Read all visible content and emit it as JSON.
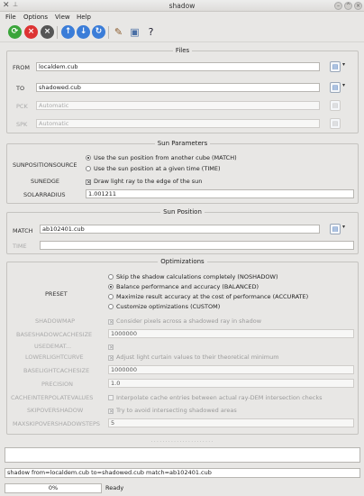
{
  "window": {
    "title": "shadow"
  },
  "menu": [
    "File",
    "Options",
    "View",
    "Help"
  ],
  "toolbar": {
    "icons": [
      "run-icon",
      "stop-icon",
      "reset-icon",
      "arrow-up-icon",
      "arrow-down-icon",
      "refresh-icon",
      "edit-icon",
      "window-icon",
      "whats-this-icon"
    ]
  },
  "files": {
    "title": "Files",
    "from_label": "FROM",
    "from_value": "localdem.cub",
    "to_label": "TO",
    "to_value": "shadowed.cub",
    "pck_label": "PCK",
    "pck_placeholder": "Automatic",
    "spk_label": "SPK",
    "spk_placeholder": "Automatic"
  },
  "sun_params": {
    "title": "Sun Parameters",
    "source_label": "SUNPOSITIONSOURCE",
    "opt_match": "Use the sun position from another cube (MATCH)",
    "opt_time": "Use the sun position at a given time (TIME)",
    "sunedge_label": "SUNEDGE",
    "sunedge_text": "Draw light ray to the edge of the sun",
    "solarradius_label": "SOLARRADIUS",
    "solarradius_value": "1.001211"
  },
  "sun_position": {
    "title": "Sun Position",
    "match_label": "MATCH",
    "match_value": "ab102401.cub",
    "time_label": "TIME",
    "time_value": ""
  },
  "optimizations": {
    "title": "Optimizations",
    "preset_label": "PRESET",
    "opt_noshadow": "Skip the shadow calculations completely (NOSHADOW)",
    "opt_balanced": "Balance performance and accuracy (BALANCED)",
    "opt_accurate": "Maximize result accuracy at the cost of performance (ACCURATE)",
    "opt_custom": "Customize optimizations (CUSTOM)",
    "shadowmap_label": "SHADOWMAP",
    "shadowmap_text": "Consider pixels across a shadowed ray in shadow",
    "baseshadow_label": "BASESHADOWCACHESIZE",
    "baseshadow_value": "1000000",
    "usedem_label": "USEDEMAT...",
    "lowerlight_label": "LOWERLIGHTCURVE",
    "lowerlight_text": "Adjust light curtain values to their theoretical minimum",
    "baselight_label": "BASELIGHTCACHESIZE",
    "baselight_value": "1000000",
    "precision_label": "PRECISION",
    "precision_value": "1.0",
    "cacheinterp_label": "CACHEINTERPOLATEVALUES",
    "cacheinterp_text": "Interpolate cache entries between actual ray-DEM intersection checks",
    "skipovershadow_label": "SKIPOVERSHADOW",
    "skipovershadow_text": "Try to avoid intersecting shadowed areas",
    "maxskip_label": "MAXSKIPOVERSHADOWSTEPS",
    "maxskip_value": "5"
  },
  "command": "shadow from=localdem.cub to=shadowed.cub match=ab102401.cub",
  "progress": "0%",
  "status": "Ready"
}
